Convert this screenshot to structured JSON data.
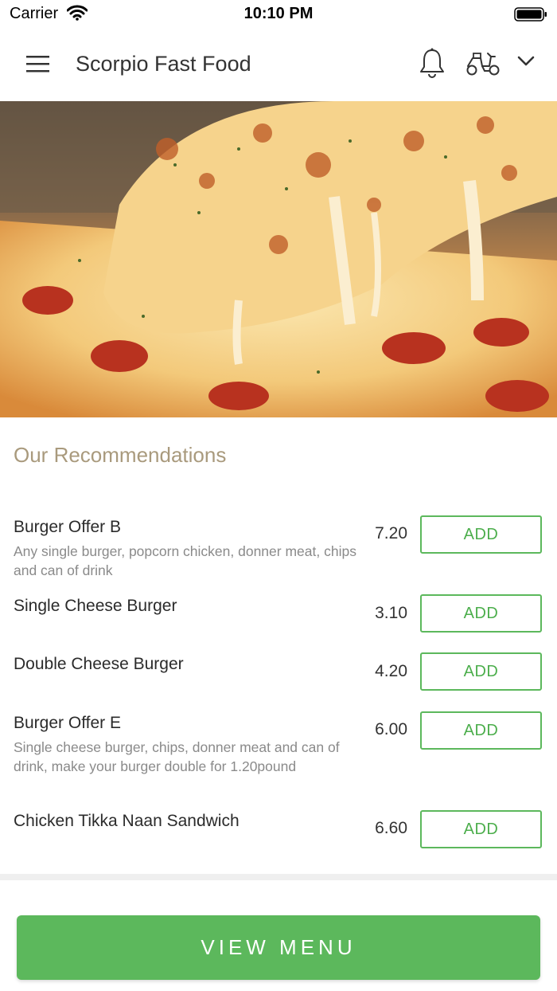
{
  "status_bar": {
    "carrier": "Carrier",
    "time": "10:10 PM"
  },
  "header": {
    "title": "Scorpio Fast Food",
    "icons": [
      "menu-icon",
      "bell-icon",
      "scooter-icon",
      "chevron-down-icon"
    ]
  },
  "recommendations": {
    "title": "Our Recommendations",
    "items": [
      {
        "name": "Burger Offer B",
        "description": "Any single burger, popcorn chicken, donner meat, chips and can of drink",
        "price": "7.20",
        "button": "ADD"
      },
      {
        "name": "Single Cheese Burger",
        "description": "",
        "price": "3.10",
        "button": "ADD"
      },
      {
        "name": "Double Cheese Burger",
        "description": "",
        "price": "4.20",
        "button": "ADD"
      },
      {
        "name": "Burger Offer E",
        "description": "Single cheese burger, chips, donner meat and can of drink, make your burger double for 1.20pound",
        "price": "6.00",
        "button": "ADD"
      },
      {
        "name": "Chicken Tikka Naan Sandwich",
        "description": "",
        "price": "6.60",
        "button": "ADD"
      }
    ]
  },
  "footer": {
    "view_menu_label": "VIEW MENU"
  },
  "colors": {
    "accent_green": "#5cb85c",
    "section_title": "#a99a7d",
    "text": "#2b2b2b",
    "muted": "#8a8a8a"
  }
}
